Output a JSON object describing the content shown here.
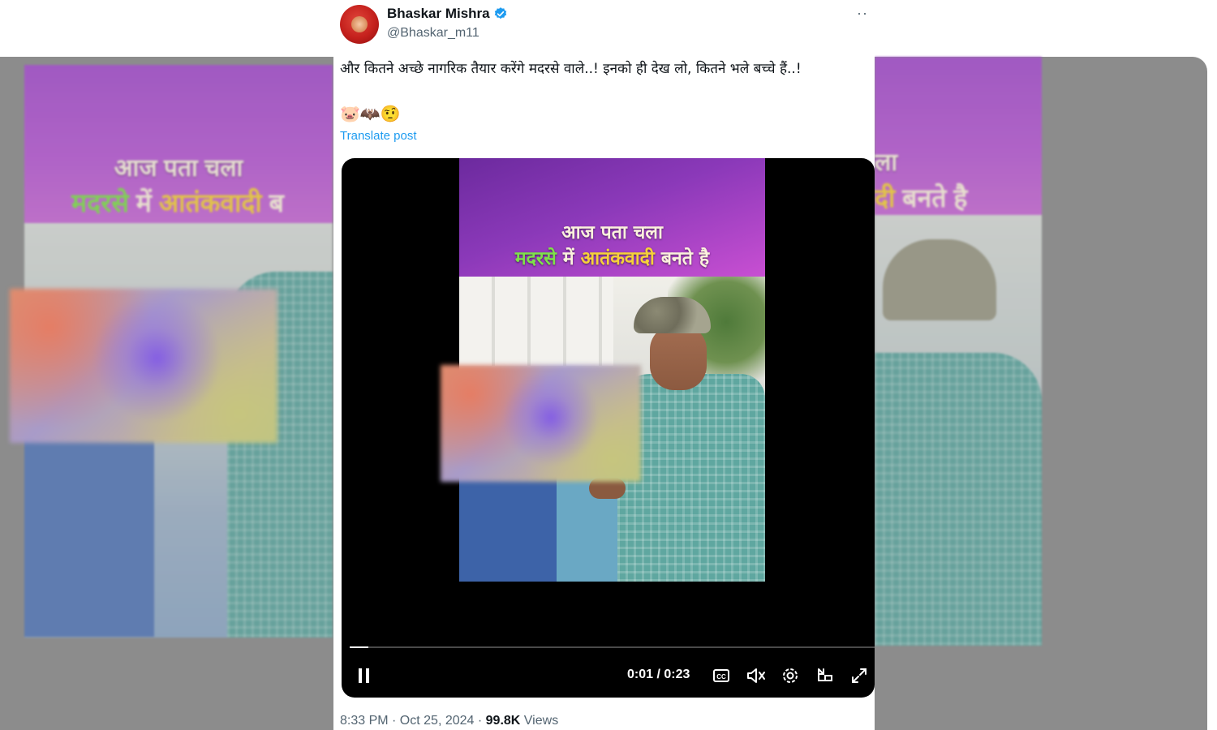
{
  "backdrop": {
    "left_line1": "आज पता चला",
    "left_line2_green": "मदरसे",
    "left_line2_mid": " में ",
    "left_line2_yellow": "आतंकवादी",
    "left_line2_end": " ब",
    "right_line1": "ला",
    "right_line2_yellow": "दी",
    "right_line2_end": " बनते है"
  },
  "tweet": {
    "author_name": "Bhaskar Mishra",
    "handle": "@Bhaskar_m11",
    "more_label": "··",
    "text": "और कितने अच्छे नागरिक तैयार करेंगे मदरसे वाले..! इनको ही देख लो, कितने भले बच्चे हैं..!",
    "emojis": "🐷🦇🤨",
    "translate_label": "Translate post",
    "timestamp": "8:33 PM · Oct 25, 2024",
    "views_count": "99.8K",
    "views_label": "Views"
  },
  "video": {
    "title_line1": "आज पता चला",
    "title_line2_green": "मदरसे",
    "title_line2_mid": " में ",
    "title_line2_yellow": "आतंकवादी",
    "title_line2_end": " बनते है",
    "time_display": "0:01 / 0:23",
    "progress_fraction": 0.035,
    "icons": [
      "pause-icon",
      "captions-icon",
      "mute-icon",
      "settings-icon",
      "pip-icon",
      "fullscreen-icon"
    ]
  },
  "colors": {
    "link": "#1d9bf0",
    "verified": "#1d9bf0",
    "title_green": "#7ee04a",
    "title_yellow": "#f5d13a"
  }
}
